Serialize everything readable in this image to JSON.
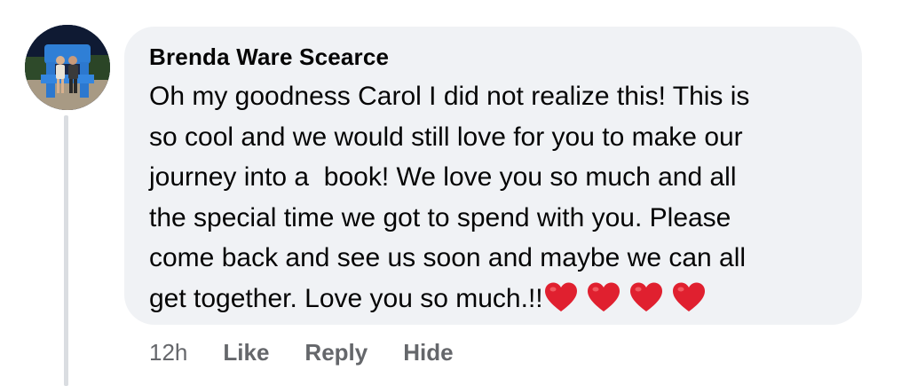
{
  "comment": {
    "author": "Brenda Ware Scearce",
    "text": "Oh my goodness Carol I did not realize this! This is\nso cool and we would still love for you to make our\njourney into a  book! We love you so much and all\nthe special time we got to spend with you. Please\ncome back and see us soon and maybe we can all\nget together. Love you so much.!!",
    "emoji": [
      "red-heart",
      "red-heart",
      "red-heart",
      "red-heart"
    ],
    "timestamp": "12h",
    "actions": {
      "like": "Like",
      "reply": "Reply",
      "hide": "Hide"
    }
  },
  "colors": {
    "bubble_bg": "#f0f2f5",
    "text": "#050505",
    "meta_text": "#65676b",
    "thread_line": "#dadde1",
    "heart": "#e0202f"
  }
}
